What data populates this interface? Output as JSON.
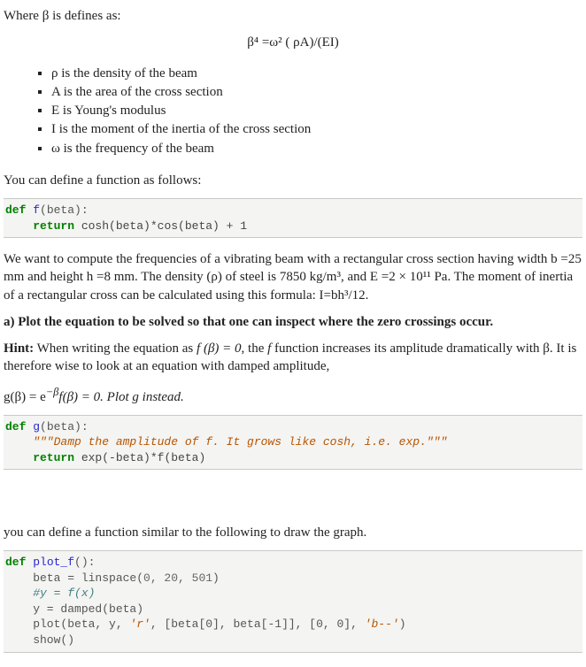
{
  "intro": "Where β is defines as:",
  "eq_main": "β⁴ =ω² ( ρA)/(EI)",
  "bullets": [
    "ρ is the density of the beam",
    "A is the area of the cross section",
    "E is Young's modulus",
    "I is the moment of the inertia of the cross section",
    "ω is the frequency of the beam"
  ],
  "define_fn": "You can define a function as follows:",
  "code1": {
    "def": "def ",
    "name": "f",
    "sig": "(beta):",
    "ret": "    return ",
    "body": "cosh(beta)*cos(beta) + 1"
  },
  "para2": "We want to compute the frequencies of a vibrating beam with a rectangular cross section having width b =25 mm and height h =8 mm. The density (ρ) of steel is 7850  kg/m³, and E =2 × 10¹¹ Pa. The moment of inertia of a rectangular cross can be calculated using this formula: I=bh³/12.",
  "q_a": "a) Plot the equation to be solved so that one can inspect where the zero crossings occur.",
  "hint_label": "Hint:",
  "hint_text_1": " When writing the equation as ",
  "hint_fbeta": "f (β) = 0",
  "hint_text_2": ", the ",
  "hint_f": "f",
  "hint_text_3": " function increases its amplitude dramatically with β.  It is therefore wise to look at an equation with damped amplitude,",
  "eq_g_before": "g(β) = e",
  "eq_g_sup": "−β",
  "eq_g_after": "f(β) = 0. Plot g instead.",
  "code2": {
    "def": "def ",
    "name": "g",
    "sig": "(beta):",
    "doc": "    \"\"\"Damp the amplitude of f. It grows like cosh, i.e. exp.\"\"\"",
    "ret": "    return ",
    "body": "exp(-beta)*f(beta)"
  },
  "para3": "you can define a function similar to the following to draw the graph.",
  "code3": {
    "def": "def ",
    "name": "plot_f",
    "sig": "():",
    "l1a": "    beta = linspace(",
    "l1b": "0, 20, 501",
    "l1c": ")",
    "l2": "    #y = f(x)",
    "l3": "    y = damped(beta)",
    "l4a": "    plot(beta, y, ",
    "l4b": "'r'",
    "l4c": ", [beta[0], beta[-1]], [0, 0], ",
    "l4d": "'b--'",
    "l4e": ")",
    "l5": "    show()"
  }
}
